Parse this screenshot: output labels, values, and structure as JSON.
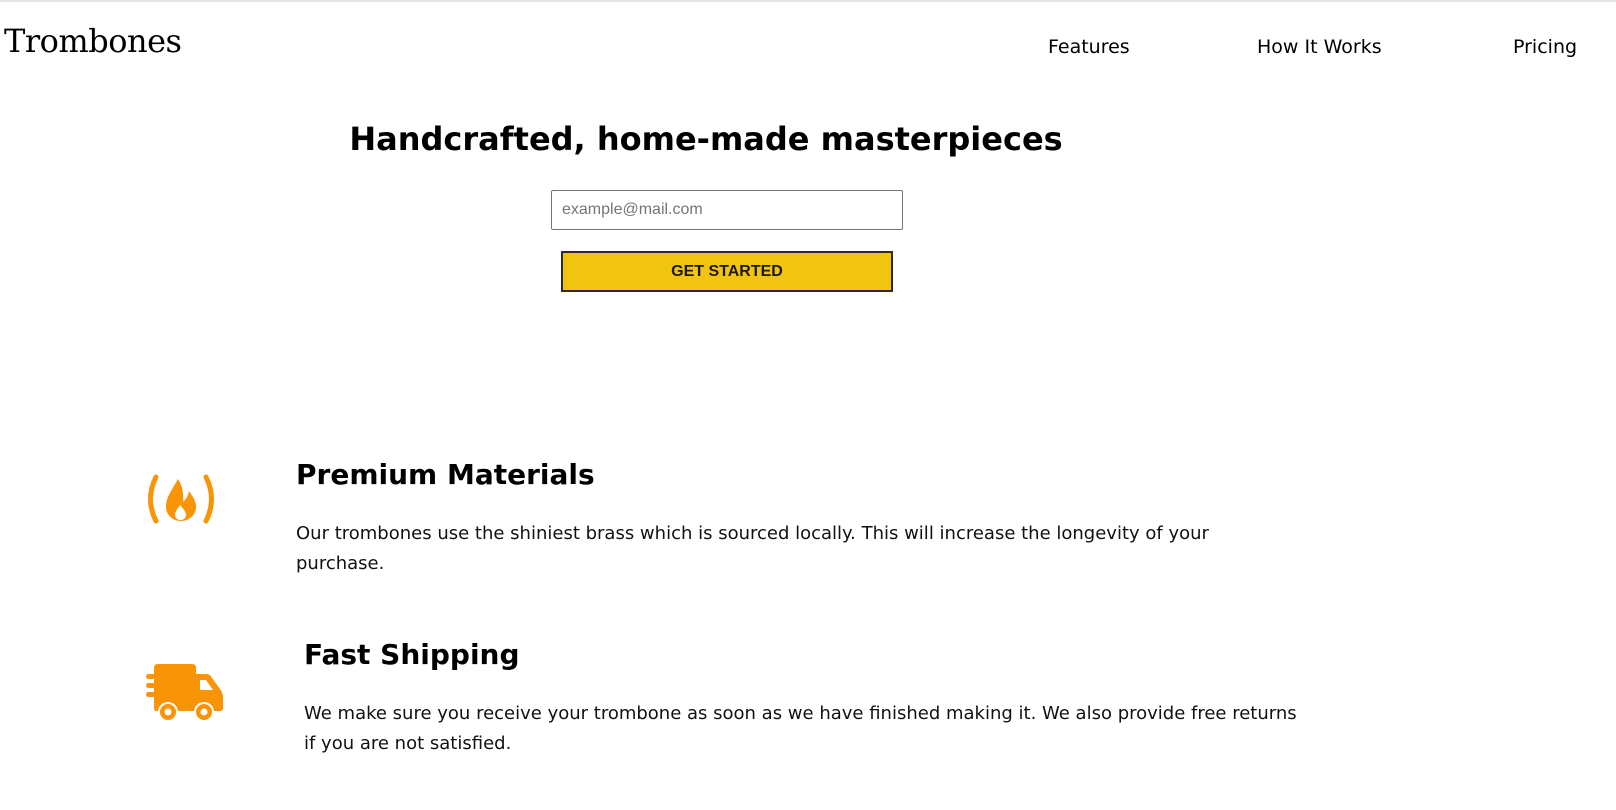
{
  "header": {
    "logo": "Trombones",
    "nav": [
      {
        "label": "Features"
      },
      {
        "label": "How It Works"
      },
      {
        "label": "Pricing"
      }
    ]
  },
  "hero": {
    "title": "Handcrafted, home-made masterpieces",
    "email_placeholder": "example@mail.com",
    "cta_label": "GET STARTED"
  },
  "features": [
    {
      "icon": "fire-icon",
      "title": "Premium Materials",
      "description": "Our trombones use the shiniest brass which is sourced locally. This will increase the longevity of your purchase."
    },
    {
      "icon": "shipping-truck-icon",
      "title": "Fast Shipping",
      "description": "We make sure you receive your trombone as soon as we have finished making it. We also provide free returns if you are not satisfied."
    }
  ],
  "colors": {
    "accent": "#f1c40f",
    "icon": "#f89406",
    "text": "#000000"
  }
}
